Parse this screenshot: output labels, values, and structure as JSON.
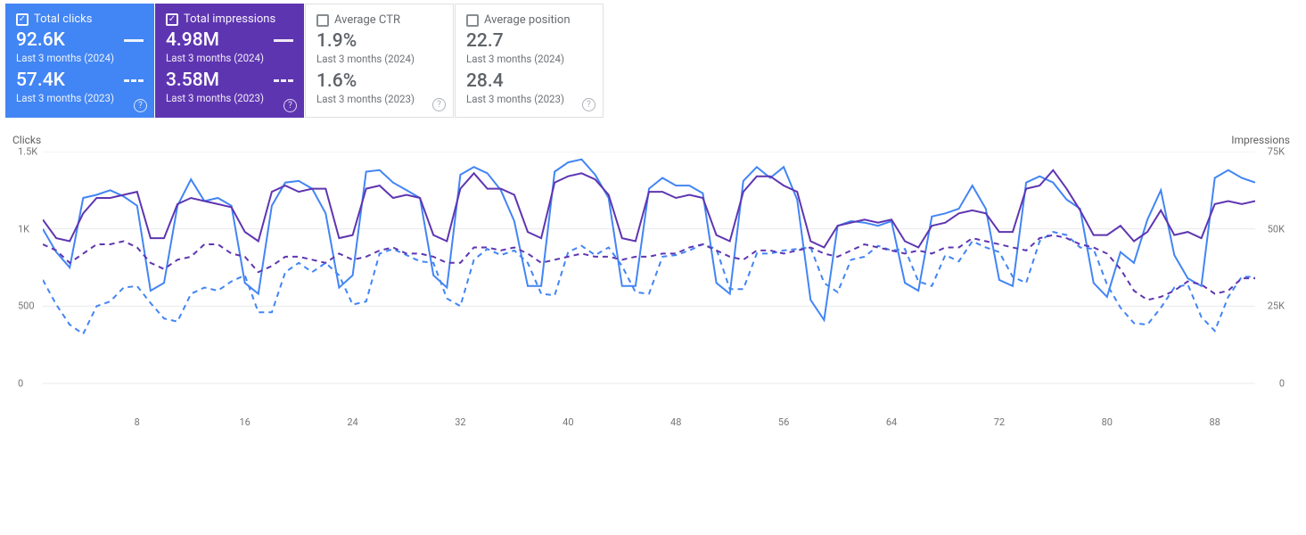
{
  "cards": [
    {
      "key": "clicks",
      "label": "Total clicks",
      "active": true,
      "color": "#4285f4",
      "v1": "92.6K",
      "s1": "Last 3 months (2024)",
      "v2": "57.4K",
      "s2": "Last 3 months (2023)"
    },
    {
      "key": "impressions",
      "label": "Total impressions",
      "active": true,
      "color": "#5e35b1",
      "v1": "4.98M",
      "s1": "Last 3 months (2024)",
      "v2": "3.58M",
      "s2": "Last 3 months (2023)"
    },
    {
      "key": "ctr",
      "label": "Average CTR",
      "active": false,
      "color": "#5f6368",
      "v1": "1.9%",
      "s1": "Last 3 months (2024)",
      "v2": "1.6%",
      "s2": "Last 3 months (2023)"
    },
    {
      "key": "position",
      "label": "Average position",
      "active": false,
      "color": "#5f6368",
      "v1": "22.7",
      "s1": "Last 3 months (2024)",
      "v2": "28.4",
      "s2": "Last 3 months (2023)"
    }
  ],
  "chart": {
    "ylabel_left": "Clicks",
    "ylabel_right": "Impressions",
    "yticks_left": [
      {
        "v": 0,
        "l": "0"
      },
      {
        "v": 500,
        "l": "500"
      },
      {
        "v": 1000,
        "l": "1K"
      },
      {
        "v": 1500,
        "l": "1.5K"
      }
    ],
    "yticks_right": [
      {
        "v": 0,
        "l": "0"
      },
      {
        "v": 25000,
        "l": "25K"
      },
      {
        "v": 50000,
        "l": "50K"
      },
      {
        "v": 75000,
        "l": "75K"
      }
    ],
    "xticks": [
      8,
      16,
      24,
      32,
      40,
      48,
      56,
      64,
      72,
      80,
      88
    ]
  },
  "chart_data": {
    "type": "line",
    "xlabel": "",
    "ylabel_left": "Clicks",
    "ylabel_right": "Impressions",
    "ylim_left": [
      0,
      1500
    ],
    "ylim_right": [
      0,
      75000
    ],
    "xlim": [
      1,
      91
    ],
    "series": [
      {
        "name": "Clicks (2024)",
        "axis": "left",
        "color": "#4285f4",
        "dashed": false,
        "values": [
          1000,
          850,
          750,
          1200,
          1220,
          1250,
          1210,
          1150,
          600,
          650,
          1150,
          1320,
          1180,
          1200,
          1150,
          650,
          580,
          1150,
          1300,
          1310,
          1260,
          1100,
          620,
          700,
          1370,
          1380,
          1300,
          1250,
          1200,
          700,
          620,
          1350,
          1400,
          1360,
          1250,
          1050,
          630,
          630,
          1370,
          1430,
          1450,
          1350,
          1200,
          630,
          630,
          1260,
          1330,
          1280,
          1280,
          1230,
          650,
          580,
          1310,
          1400,
          1330,
          1400,
          1190,
          540,
          410,
          1020,
          1050,
          1040,
          1020,
          1050,
          650,
          600,
          1080,
          1100,
          1130,
          1280,
          1130,
          670,
          630,
          1300,
          1340,
          1300,
          1190,
          1130,
          650,
          560,
          850,
          780,
          1060,
          1250,
          830,
          680,
          630,
          1330,
          1380,
          1330,
          1300
        ]
      },
      {
        "name": "Clicks (2023)",
        "axis": "left",
        "color": "#4285f4",
        "dashed": true,
        "values": [
          670,
          510,
          380,
          320,
          500,
          530,
          620,
          630,
          520,
          420,
          400,
          580,
          620,
          600,
          660,
          700,
          460,
          460,
          720,
          780,
          720,
          780,
          700,
          510,
          530,
          840,
          870,
          830,
          790,
          780,
          550,
          500,
          800,
          870,
          830,
          860,
          780,
          580,
          570,
          850,
          890,
          830,
          880,
          760,
          590,
          580,
          820,
          830,
          860,
          900,
          870,
          610,
          610,
          840,
          840,
          860,
          870,
          880,
          650,
          590,
          800,
          820,
          890,
          860,
          870,
          660,
          630,
          830,
          790,
          920,
          880,
          850,
          690,
          650,
          920,
          980,
          960,
          880,
          870,
          640,
          490,
          390,
          380,
          490,
          620,
          640,
          430,
          340,
          560,
          690,
          690
        ]
      },
      {
        "name": "Impressions (2024)",
        "axis": "right",
        "color": "#5e35b1",
        "dashed": false,
        "values": [
          53000,
          47000,
          46000,
          55000,
          60000,
          60000,
          61000,
          62000,
          47000,
          47000,
          58000,
          60000,
          59000,
          58000,
          57000,
          49000,
          46000,
          62000,
          64000,
          62000,
          63000,
          63000,
          47000,
          48000,
          63000,
          64000,
          60000,
          61000,
          60000,
          48000,
          46000,
          63000,
          68000,
          63000,
          63000,
          61000,
          49000,
          47000,
          65000,
          67000,
          68000,
          66000,
          61000,
          47000,
          46000,
          62000,
          62000,
          60000,
          61000,
          60000,
          48000,
          46000,
          62000,
          67000,
          67000,
          64000,
          62000,
          46000,
          44000,
          51000,
          52000,
          53000,
          52000,
          53000,
          46000,
          44000,
          51000,
          52000,
          55000,
          56000,
          55000,
          49000,
          49000,
          63000,
          64000,
          69000,
          63000,
          56000,
          48000,
          48000,
          51000,
          46000,
          49000,
          56000,
          48000,
          49000,
          47000,
          58000,
          59000,
          58000,
          59000
        ]
      },
      {
        "name": "Impressions (2023)",
        "axis": "right",
        "color": "#5e35b1",
        "dashed": true,
        "values": [
          45000,
          43000,
          39000,
          42000,
          45000,
          45000,
          46000,
          44000,
          39000,
          37000,
          40000,
          41000,
          45000,
          45000,
          42000,
          41000,
          36000,
          38000,
          41000,
          41000,
          40000,
          39000,
          42000,
          40000,
          41000,
          43000,
          44000,
          42000,
          42000,
          41000,
          39000,
          39000,
          44000,
          44000,
          43000,
          44000,
          42000,
          39000,
          40000,
          41000,
          42000,
          41000,
          41000,
          40000,
          41000,
          41000,
          42000,
          42000,
          44000,
          45000,
          43000,
          41000,
          40000,
          43000,
          43000,
          42000,
          43000,
          44000,
          42000,
          41000,
          43000,
          45000,
          44000,
          43000,
          42000,
          43000,
          42000,
          44000,
          44000,
          47000,
          46000,
          45000,
          44000,
          43000,
          47000,
          48000,
          47000,
          45000,
          44000,
          42000,
          37000,
          30000,
          27000,
          28000,
          30000,
          33000,
          32000,
          29000,
          30000,
          34000,
          34000
        ]
      }
    ]
  }
}
